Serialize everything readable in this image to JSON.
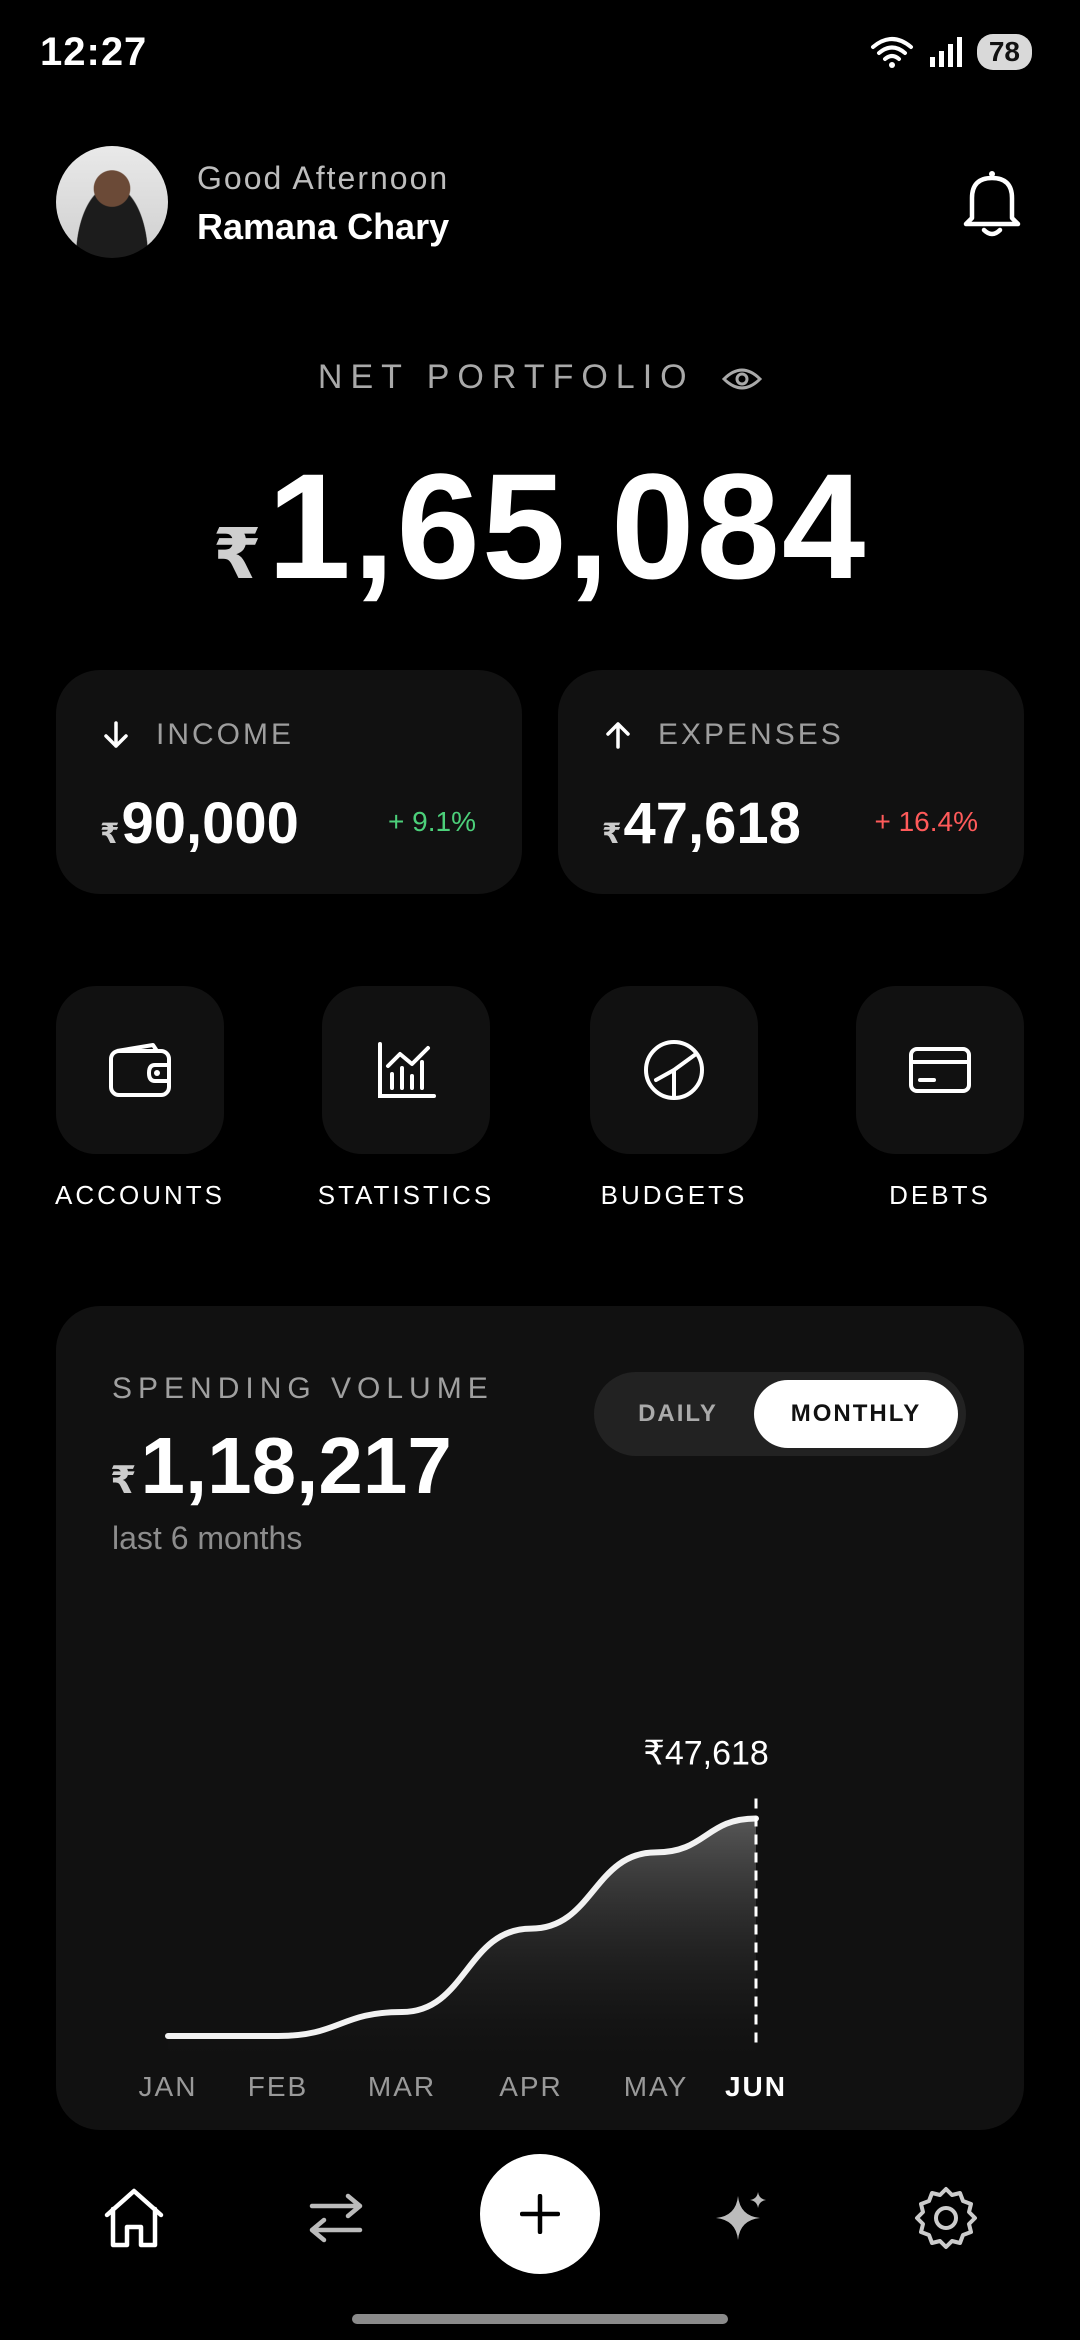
{
  "status": {
    "time": "12:27",
    "battery": "78"
  },
  "header": {
    "greeting": "Good Afternoon",
    "user_name": "Ramana Chary"
  },
  "portfolio": {
    "label": "NET PORTFOLIO",
    "currency": "₹",
    "value": "1,65,084"
  },
  "summary": {
    "income": {
      "label": "INCOME",
      "currency": "₹",
      "value": "90,000",
      "change": "+ 9.1%",
      "color": "#4cd07a"
    },
    "expenses": {
      "label": "EXPENSES",
      "currency": "₹",
      "value": "47,618",
      "change": "+ 16.4%",
      "color": "#ff5a5a"
    }
  },
  "actions": [
    {
      "label": "ACCOUNTS",
      "icon": "wallet-icon"
    },
    {
      "label": "STATISTICS",
      "icon": "bar-chart-icon"
    },
    {
      "label": "BUDGETS",
      "icon": "pie-chart-icon"
    },
    {
      "label": "DEBTS",
      "icon": "credit-card-icon"
    }
  ],
  "spending": {
    "label": "SPENDING VOLUME",
    "currency": "₹",
    "value": "1,18,217",
    "period": "last 6 months",
    "toggle": {
      "daily": "DAILY",
      "monthly": "MONTHLY",
      "selected": "MONTHLY"
    },
    "highlight_label": "₹47,618"
  },
  "chart_data": {
    "type": "area",
    "categories": [
      "JAN",
      "FEB",
      "MAR",
      "APR",
      "MAY",
      "JUN"
    ],
    "active_category": "JUN",
    "values": [
      0,
      0,
      8500,
      38000,
      65000,
      77000
    ],
    "highlight": {
      "category": "JUN",
      "label": "₹47,618"
    },
    "grid": false
  },
  "nav": [
    {
      "name": "home",
      "icon": "home-icon"
    },
    {
      "name": "transfer",
      "icon": "transfer-icon"
    },
    {
      "name": "add",
      "icon": "plus-icon"
    },
    {
      "name": "ai",
      "icon": "sparkle-icon"
    },
    {
      "name": "settings",
      "icon": "gear-icon"
    }
  ]
}
